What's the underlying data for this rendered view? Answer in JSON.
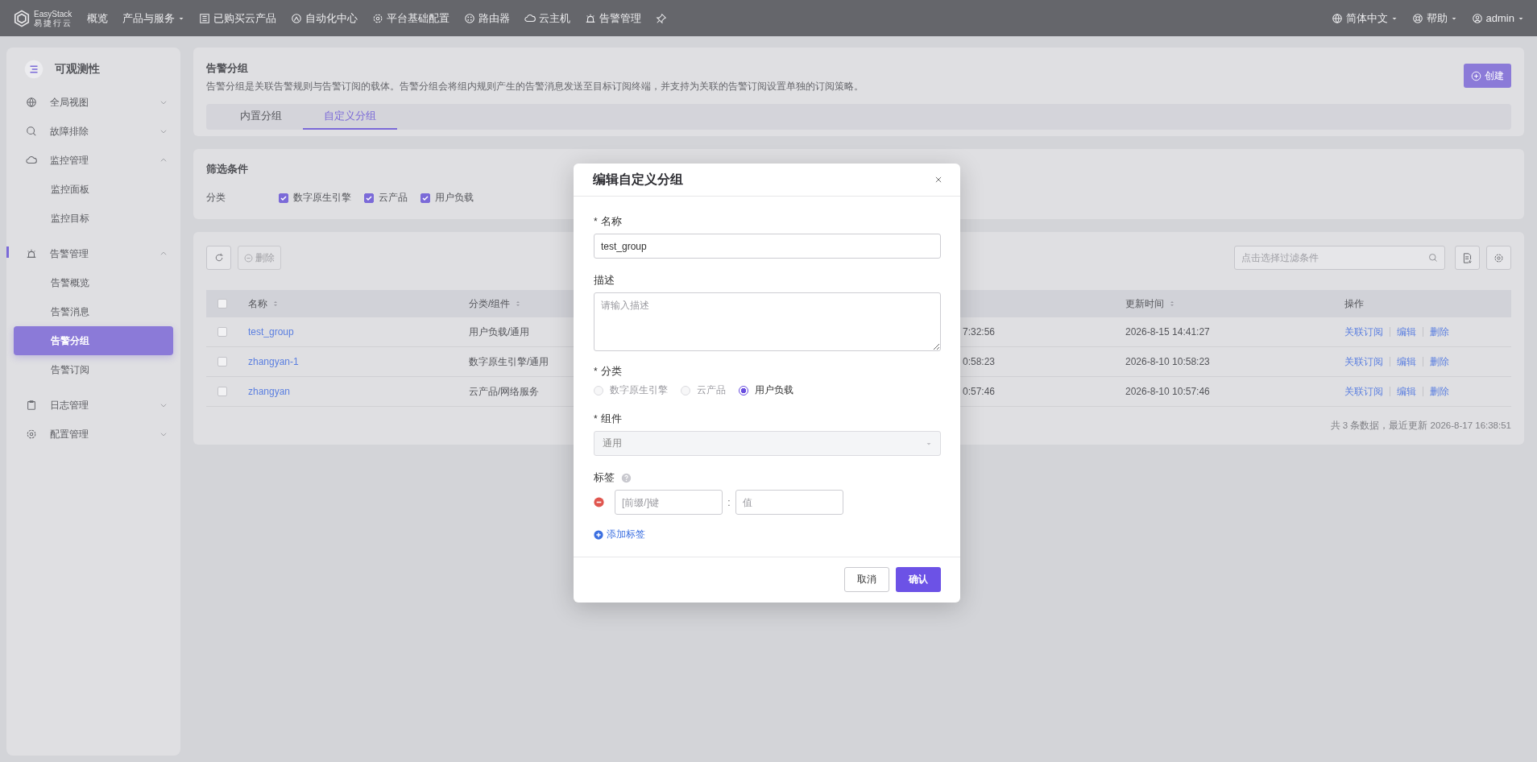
{
  "top_bar": {
    "logo": {
      "name": "EasyStack",
      "subtitle": "易捷行云"
    },
    "nav": [
      {
        "label": "概览",
        "dropdown": false
      },
      {
        "label": "产品与服务",
        "dropdown": true
      },
      {
        "label": "已购买云产品",
        "dropdown": false
      },
      {
        "label": "自动化中心",
        "dropdown": false
      },
      {
        "label": "平台基础配置",
        "dropdown": false
      },
      {
        "label": "路由器",
        "dropdown": false
      },
      {
        "label": "云主机",
        "dropdown": false
      },
      {
        "label": "告警管理",
        "dropdown": false
      }
    ],
    "right": [
      {
        "label": "简体中文"
      },
      {
        "label": "帮助"
      },
      {
        "label": "admin"
      }
    ]
  },
  "sidebar": {
    "title": "可观测性",
    "items": [
      {
        "label": "全局视图",
        "expanded": false
      },
      {
        "label": "故障排除",
        "expanded": false
      },
      {
        "label": "监控管理",
        "expanded": true,
        "children": [
          {
            "label": "监控面板",
            "selected": false
          },
          {
            "label": "监控目标",
            "selected": false
          }
        ]
      },
      {
        "label": "告警管理",
        "expanded": true,
        "children": [
          {
            "label": "告警概览",
            "selected": false
          },
          {
            "label": "告警消息",
            "selected": false
          },
          {
            "label": "告警分组",
            "selected": true
          },
          {
            "label": "告警订阅",
            "selected": false
          }
        ]
      },
      {
        "label": "日志管理",
        "expanded": false
      },
      {
        "label": "配置管理",
        "expanded": false
      }
    ]
  },
  "header": {
    "title": "告警分组",
    "description": "告警分组是关联告警规则与告警订阅的载体。告警分组会将组内规则产生的告警消息发送至目标订阅终端，并支持为关联的告警订阅设置单独的订阅策略。",
    "create_button": "创建",
    "tabs": [
      {
        "label": "内置分组",
        "selected": false
      },
      {
        "label": "自定义分组",
        "selected": true
      }
    ]
  },
  "filter": {
    "title": "筛选条件",
    "label": "分类",
    "options": [
      {
        "label": "数字原生引擎",
        "checked": true
      },
      {
        "label": "云产品",
        "checked": true
      },
      {
        "label": "用户负载",
        "checked": true
      }
    ]
  },
  "table": {
    "select_all_checked": false,
    "delete_button": "删除",
    "search_placeholder": "点击选择过滤条件",
    "columns": [
      "名称",
      "分类/组件",
      "",
      "更新时间",
      "操作"
    ],
    "rows": [
      {
        "checked": false,
        "name": "test_group",
        "category": "用户负载/通用",
        "column_3": "7:32:56",
        "updated": "2026-8-15 14:41:27",
        "actions": [
          "关联订阅",
          "编辑",
          "删除"
        ]
      },
      {
        "checked": false,
        "name": "zhangyan-1",
        "category": "数字原生引擎/通用",
        "column_3": "0:58:23",
        "updated": "2026-8-10 10:58:23",
        "actions": [
          "关联订阅",
          "编辑",
          "删除"
        ]
      },
      {
        "checked": false,
        "name": "zhangyan",
        "category": "云产品/网络服务",
        "column_3": "0:57:46",
        "updated": "2026-8-10 10:57:46",
        "actions": [
          "关联订阅",
          "编辑",
          "删除"
        ]
      }
    ],
    "footer": "共 3 条数据，最近更新  2026-8-17 16:38:51"
  },
  "modal": {
    "title": "编辑自定义分组",
    "name_required_mark": "*",
    "name_label": "名称",
    "name_value": "test_group",
    "desc_label": "描述",
    "desc_placeholder": "请输入描述",
    "category_required_mark": "*",
    "category_label": "分类",
    "category_options": [
      {
        "label": "数字原生引擎",
        "selected": false
      },
      {
        "label": "云产品",
        "selected": false
      },
      {
        "label": "用户负载",
        "selected": true
      }
    ],
    "component_required_mark": "*",
    "component_label": "组件",
    "component_value": "通用",
    "tags_label": "标签",
    "tag_key_placeholder": "[前缀/]键",
    "tag_separator": ":",
    "tag_value_placeholder": "值",
    "add_tag": "添加标签",
    "cancel": "取消",
    "confirm": "确认"
  }
}
